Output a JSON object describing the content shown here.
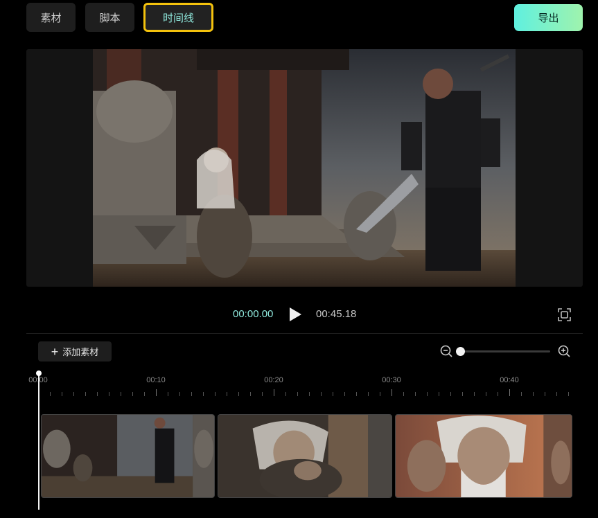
{
  "tabs": [
    {
      "label": "素材",
      "active": false
    },
    {
      "label": "脚本",
      "active": false
    },
    {
      "label": "时间线",
      "active": true
    }
  ],
  "export_label": "导出",
  "player": {
    "current_time": "00:00.00",
    "total_time": "00:45.18",
    "play_icon": "play-icon",
    "fullscreen_icon": "fullscreen-icon"
  },
  "timeline": {
    "add_label": "添加素材",
    "zoom_level": 0.0,
    "ruler_labels": [
      "00:00",
      "00:10",
      "00:20",
      "00:30",
      "00:40"
    ],
    "clips": [
      "clip-1",
      "clip-2",
      "clip-3"
    ]
  },
  "colors": {
    "accent": "#8fe8dc",
    "highlight": "#f4c20d",
    "export_from": "#5ff0df",
    "export_to": "#9ff3ad"
  }
}
